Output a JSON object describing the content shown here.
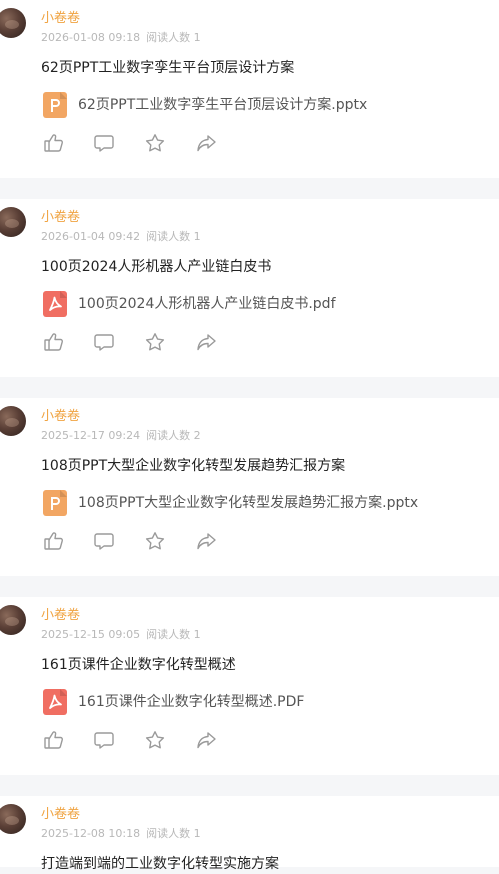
{
  "posts": [
    {
      "author": "小卷卷",
      "date": "2026-01-08 09:18",
      "reads": "阅读人数 1",
      "title": "62页PPT工业数字孪生平台顶层设计方案",
      "file_name": "62页PPT工业数字孪生平台顶层设计方案.pptx",
      "file_type_icon": "pptx-file-icon"
    },
    {
      "author": "小卷卷",
      "date": "2026-01-04 09:42",
      "reads": "阅读人数 1",
      "title": "100页2024人形机器人产业链白皮书",
      "file_name": "100页2024人形机器人产业链白皮书.pdf",
      "file_type_icon": "pdf-file-icon"
    },
    {
      "author": "小卷卷",
      "date": "2025-12-17 09:24",
      "reads": "阅读人数 2",
      "title": "108页PPT大型企业数字化转型发展趋势汇报方案",
      "file_name": "108页PPT大型企业数字化转型发展趋势汇报方案.pptx",
      "file_type_icon": "pptx-file-icon"
    },
    {
      "author": "小卷卷",
      "date": "2025-12-15 09:05",
      "reads": "阅读人数 1",
      "title": "161页课件企业数字化转型概述",
      "file_name": "161页课件企业数字化转型概述.PDF",
      "file_type_icon": "pdf-file-icon"
    },
    {
      "author": "小卷卷",
      "date": "2025-12-08 10:18",
      "reads": "阅读人数 1",
      "title": "打造端到端的工业数字化转型实施方案"
    }
  ],
  "icons": {
    "like": "thumbs-up-icon",
    "comment": "comment-icon",
    "favorite": "star-icon",
    "share": "share-icon"
  },
  "colors": {
    "author": "#f0a443",
    "pptx": "#f2a663",
    "pdf": "#f06e62",
    "divider": "#f5f6f8"
  }
}
